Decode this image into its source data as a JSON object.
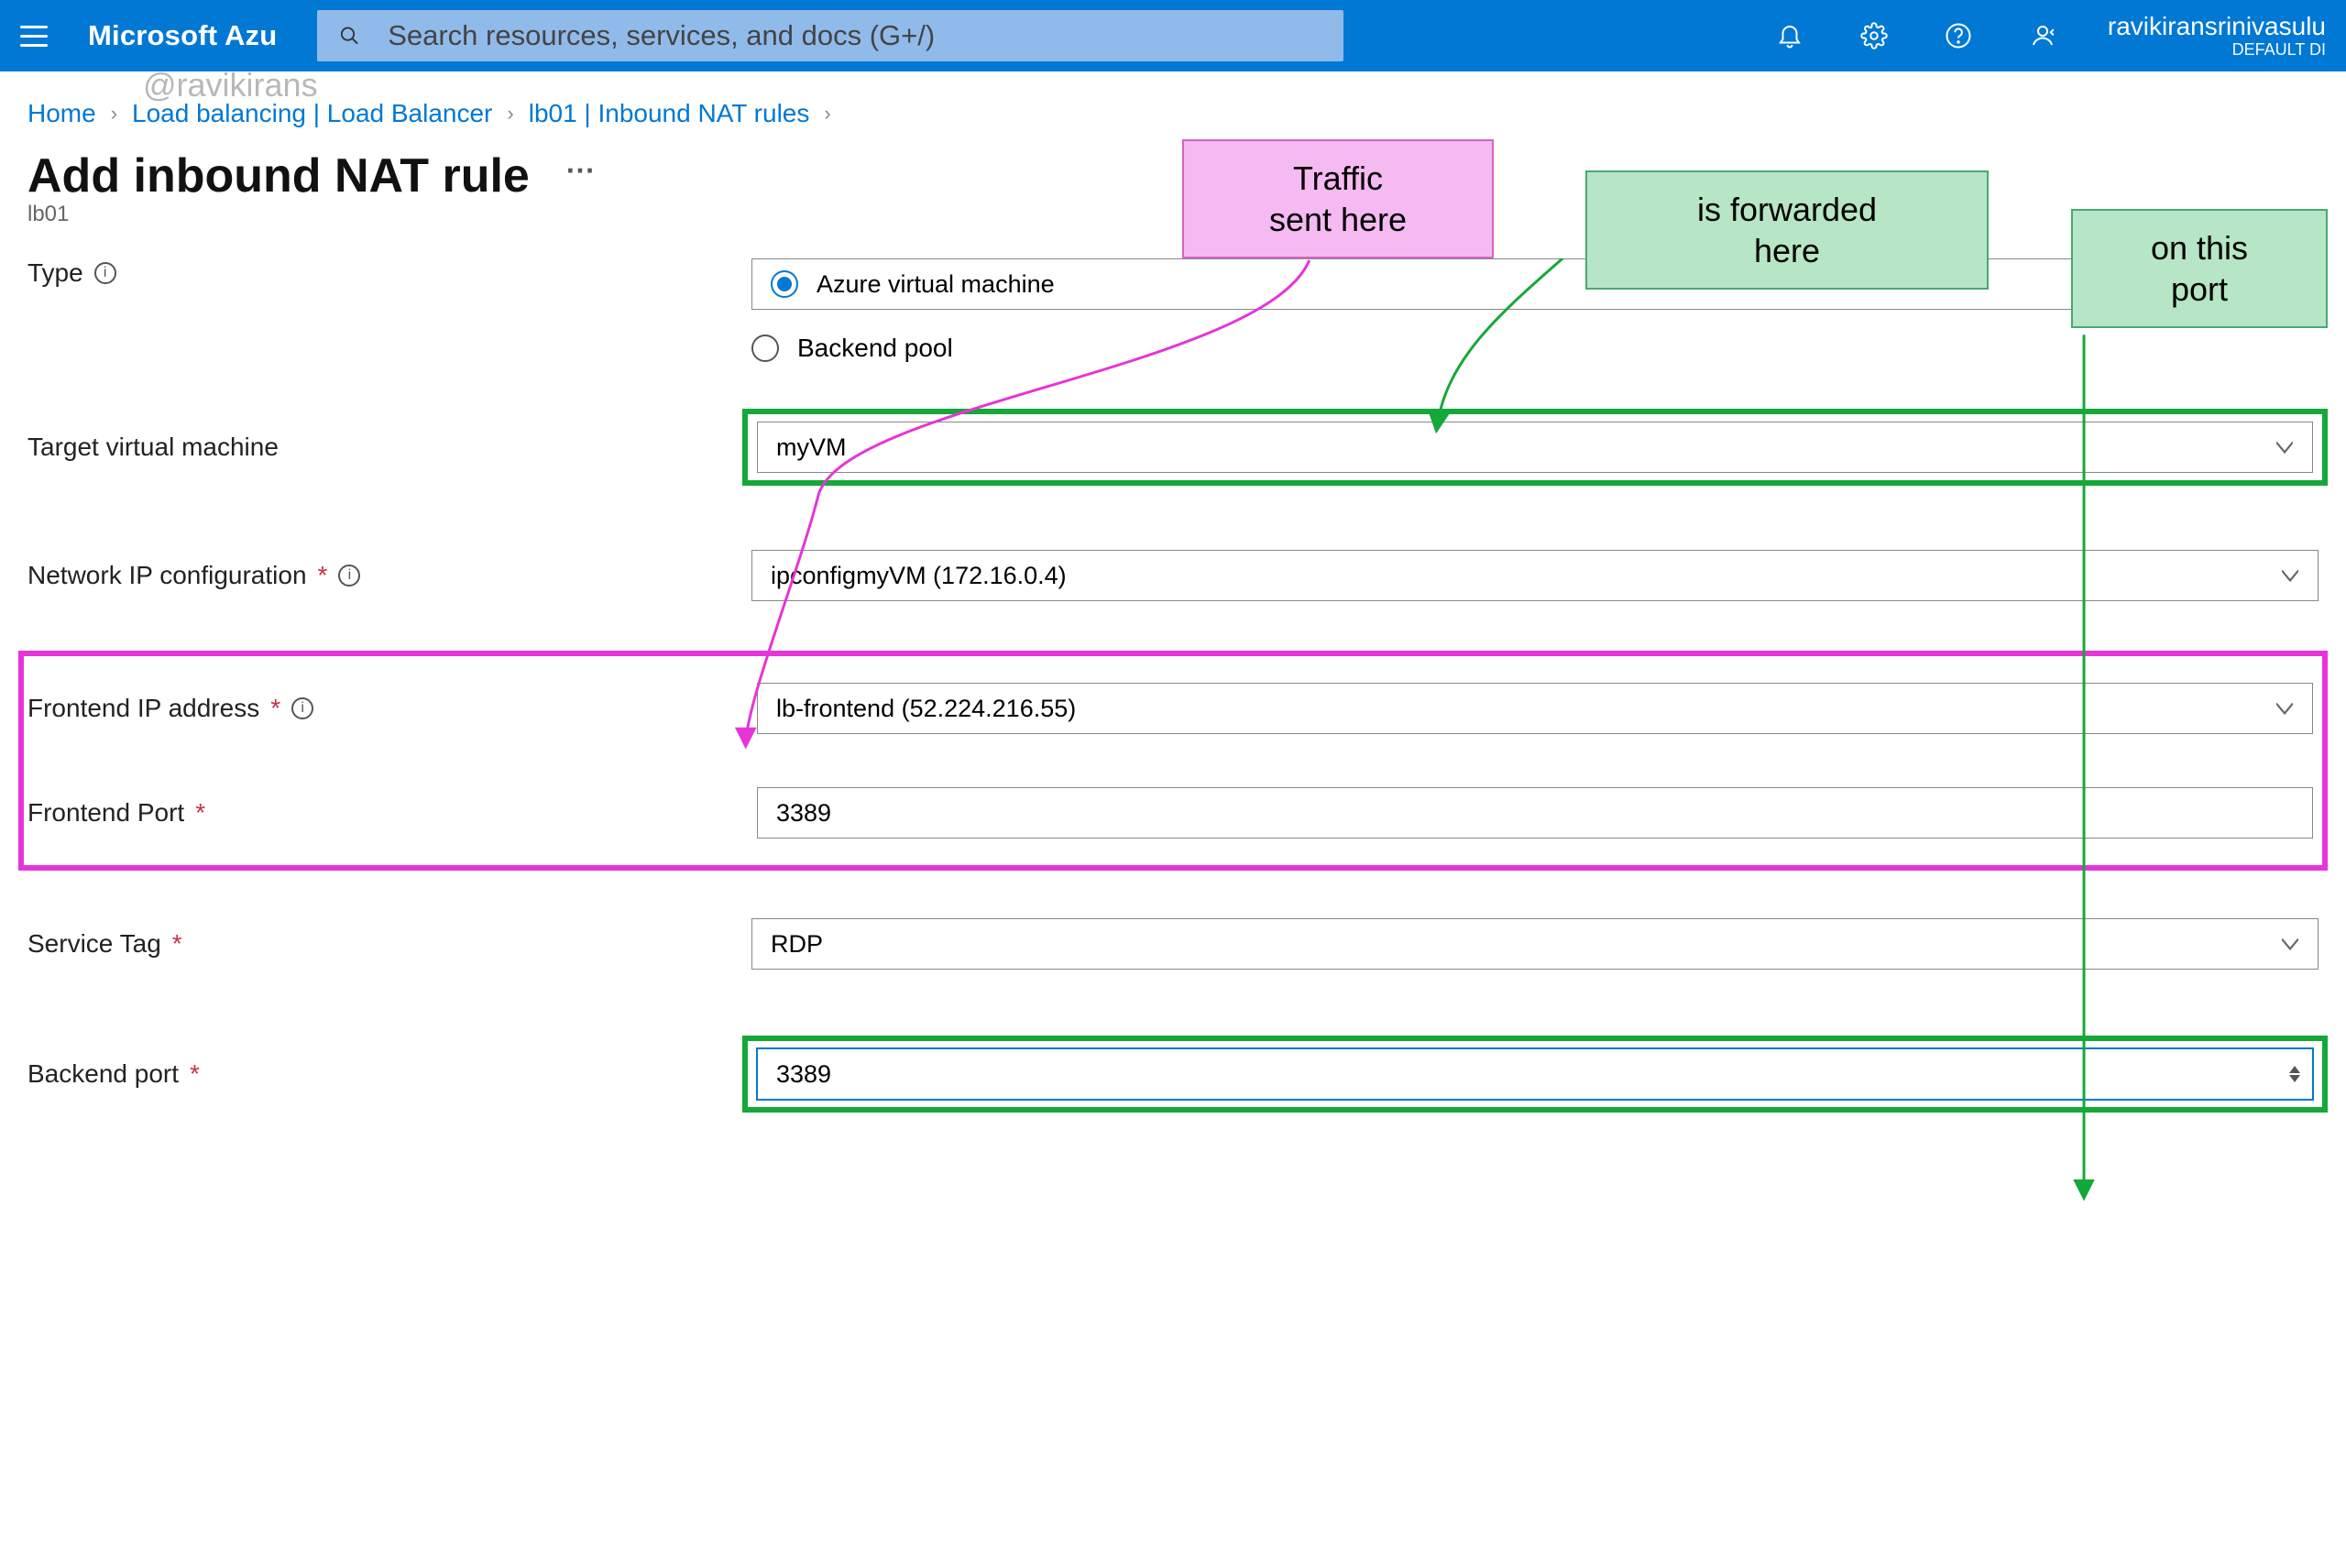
{
  "topbar": {
    "brand": "Microsoft Azu",
    "search_placeholder": "Search resources, services, and docs (G+/)",
    "account_name": "ravikiransrinivasulu",
    "account_dir": "DEFAULT DI"
  },
  "breadcrumb": {
    "items": [
      "Home",
      "Load balancing | Load Balancer",
      "lb01 | Inbound NAT rules"
    ]
  },
  "watermark": "@ravikirans",
  "page": {
    "title": "Add inbound NAT rule",
    "resource": "lb01"
  },
  "form": {
    "type_label": "Type",
    "type_options": [
      "Azure virtual machine",
      "Backend pool"
    ],
    "type_selected_index": 0,
    "target_vm_label": "Target virtual machine",
    "target_vm_value": "myVM",
    "netcfg_label": "Network IP configuration",
    "netcfg_value": "ipconfigmyVM (172.16.0.4)",
    "feip_label": "Frontend IP address",
    "feip_value": "lb-frontend (52.224.216.55)",
    "feport_label": "Frontend Port",
    "feport_value": "3389",
    "svctag_label": "Service Tag",
    "svctag_value": "RDP",
    "beport_label": "Backend port",
    "beport_value": "3389"
  },
  "callouts": {
    "sent": "Traffic\nsent here",
    "fwd": "is forwarded\nhere",
    "port": "on this\nport"
  }
}
